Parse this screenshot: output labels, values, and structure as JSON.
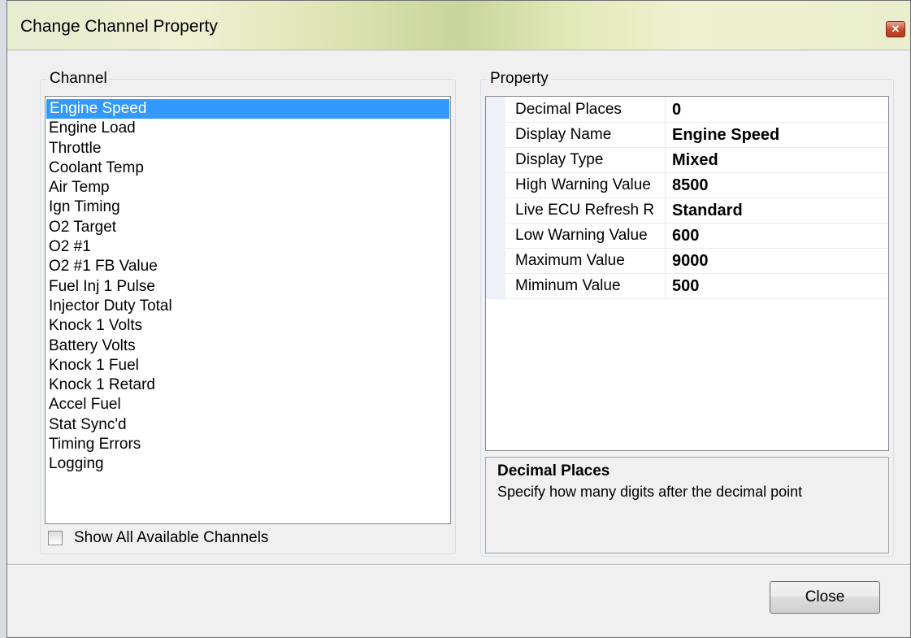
{
  "window": {
    "title": "Change Channel Property",
    "close_icon": "close-x-icon"
  },
  "channel": {
    "legend": "Channel",
    "items": [
      "Engine Speed",
      "Engine Load",
      "Throttle",
      "Coolant Temp",
      "Air Temp",
      "Ign Timing",
      "O2 Target",
      "O2 #1",
      "O2 #1 FB Value",
      "Fuel Inj 1 Pulse",
      "Injector Duty Total",
      "Knock 1 Volts",
      "Battery Volts",
      "Knock 1 Fuel",
      "Knock 1 Retard",
      "Accel Fuel",
      "Stat Sync'd",
      "Timing Errors",
      "Logging"
    ],
    "selected_index": 0,
    "show_all_label": "Show All Available Channels",
    "show_all_checked": false
  },
  "property": {
    "legend": "Property",
    "rows": [
      {
        "name": "Decimal Places",
        "value": "0"
      },
      {
        "name": "Display Name",
        "value": "Engine Speed"
      },
      {
        "name": "Display Type",
        "value": "Mixed"
      },
      {
        "name": "High Warning Value",
        "value": "8500"
      },
      {
        "name": "Live ECU Refresh R",
        "value": "Standard"
      },
      {
        "name": "Low Warning Value",
        "value": "600"
      },
      {
        "name": "Maximum Value",
        "value": "9000"
      },
      {
        "name": "Miminum Value",
        "value": "500"
      }
    ],
    "help_title": "Decimal Places",
    "help_desc": "Specify how many digits after the decimal point"
  },
  "buttons": {
    "close_label": "Close"
  },
  "colors": {
    "selection": "#3399ff",
    "titlebar_close": "#c7492c"
  }
}
